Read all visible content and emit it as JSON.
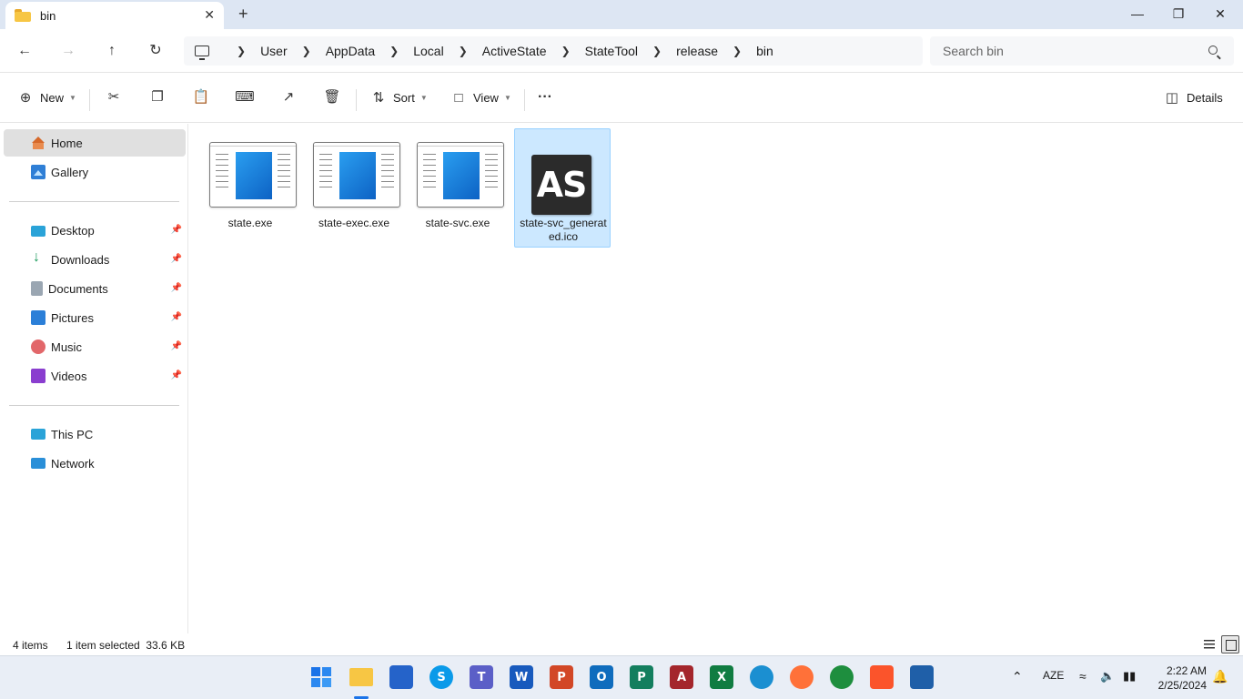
{
  "window": {
    "tab_title": "bin",
    "tab_close": "✕",
    "new_tab": "+",
    "minimize": "—",
    "maximize": "❐",
    "close": "✕"
  },
  "address": {
    "segments": [
      "User",
      "AppData",
      "Local",
      "ActiveState",
      "StateTool",
      "release",
      "bin"
    ],
    "search_placeholder": "Search bin"
  },
  "commands": {
    "new_label": "New",
    "sort_label": "Sort",
    "view_label": "View",
    "more_label": "···",
    "details_label": "Details"
  },
  "sidebar": {
    "home": "Home",
    "gallery": "Gallery",
    "quick_access": [
      {
        "label": "Desktop",
        "icon": "desktop-icon"
      },
      {
        "label": "Downloads",
        "icon": "downloads-icon"
      },
      {
        "label": "Documents",
        "icon": "documents-icon"
      },
      {
        "label": "Pictures",
        "icon": "pictures-icon"
      },
      {
        "label": "Music",
        "icon": "music-icon"
      },
      {
        "label": "Videos",
        "icon": "videos-icon"
      }
    ],
    "this_pc": "This PC",
    "network": "Network"
  },
  "files": [
    {
      "name": "state.exe",
      "type": "exe",
      "selected": false
    },
    {
      "name": "state-exec.exe",
      "type": "exe",
      "selected": false
    },
    {
      "name": "state-svc.exe",
      "type": "exe",
      "selected": false
    },
    {
      "name": "state-svc_generated.ico",
      "type": "ico",
      "icon_text": "AS",
      "selected": true
    }
  ],
  "status": {
    "item_count": "4 items",
    "selection": "1 item selected  33.6 KB"
  },
  "taskbar": {
    "apps": [
      {
        "name": "start-icon",
        "color": "#1a73e8"
      },
      {
        "name": "file-explorer-icon",
        "color": "#f7c644"
      },
      {
        "name": "microsoft-store-icon",
        "color": "#2563c9"
      },
      {
        "name": "skype-icon",
        "color": "#0a9ae9",
        "glyph": "S"
      },
      {
        "name": "teams-icon",
        "color": "#5b5fc7",
        "glyph": "T"
      },
      {
        "name": "word-icon",
        "color": "#185abd",
        "glyph": "W"
      },
      {
        "name": "powerpoint-icon",
        "color": "#d24726",
        "glyph": "P"
      },
      {
        "name": "outlook-icon",
        "color": "#0f6cbd",
        "glyph": "O"
      },
      {
        "name": "project-icon",
        "color": "#137e5e",
        "glyph": "P"
      },
      {
        "name": "access-icon",
        "color": "#a4262c",
        "glyph": "A"
      },
      {
        "name": "excel-icon",
        "color": "#107c41",
        "glyph": "X"
      },
      {
        "name": "edge-icon",
        "color": "#1b8fd1",
        "glyph": ""
      },
      {
        "name": "firefox-icon",
        "color": "#ff7139",
        "glyph": ""
      },
      {
        "name": "chrome-icon",
        "color": "#1e8e3e",
        "glyph": ""
      },
      {
        "name": "brave-icon",
        "color": "#fb542b",
        "glyph": ""
      },
      {
        "name": "remote-app-icon",
        "color": "#1f5fa8",
        "glyph": ""
      }
    ],
    "language": "AZE",
    "time": "2:22 AM",
    "date": "2/25/2024"
  }
}
